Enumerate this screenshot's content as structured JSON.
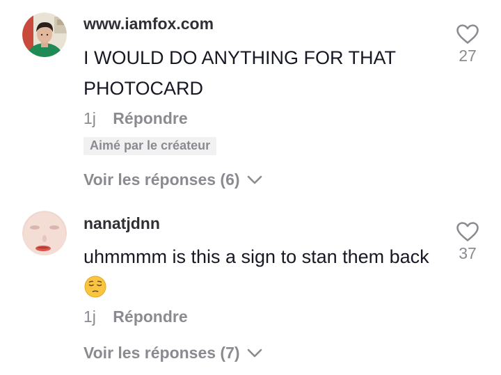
{
  "comments": [
    {
      "username": "www.iamfox.com",
      "text": "I WOULD DO ANYTHING FOR THAT PHOTOCARD",
      "age": "1j",
      "reply_label": "Répondre",
      "badge": "Aimé par le créateur",
      "view_replies_label": "Voir les réponses (6)",
      "likes": "27",
      "avatar": "user-avatar-photo"
    },
    {
      "username": "nanatjdnn",
      "text": "uhmmmm is this a sign to stan them back",
      "emoji": "pensive-face-emoji",
      "age": "1j",
      "reply_label": "Répondre",
      "view_replies_label": "Voir les réponses (7)",
      "likes": "37",
      "avatar": "user-avatar-photo"
    }
  ],
  "icons": {
    "like": "heart-outline-icon",
    "expand": "chevron-down-icon"
  },
  "colors": {
    "primary_text": "#161823",
    "username_text": "#2f3036",
    "secondary_text": "#8a8b91",
    "badge_background": "#f1f1f2",
    "background": "#ffffff"
  }
}
